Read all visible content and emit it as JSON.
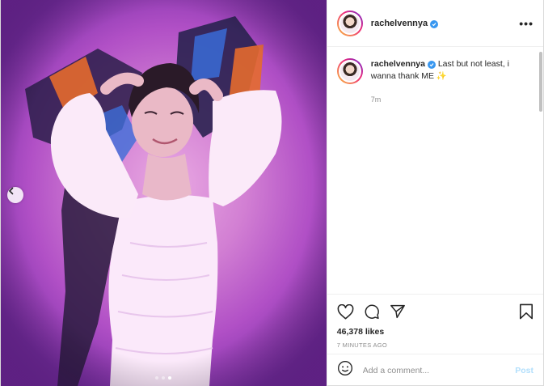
{
  "post": {
    "username": "rachelvennya",
    "verified": true,
    "caption": "Last but not least, i wanna thank ME ✨",
    "caption_time": "7m",
    "likes": "46,378 likes",
    "posted_ago": "7 MINUTES AGO",
    "carousel": {
      "total": 3,
      "active_index": 2
    }
  },
  "composer": {
    "placeholder": "Add a comment...",
    "post_label": "Post"
  },
  "icons": {
    "more": "more-options-icon",
    "like": "heart-icon",
    "comment": "comment-icon",
    "share": "send-icon",
    "save": "bookmark-icon",
    "emoji": "emoji-icon",
    "prev": "chevron-left-icon"
  },
  "colors": {
    "verified": "#3897f0",
    "post_button": "#b2dffc",
    "muted_text": "#8e8e8e"
  }
}
